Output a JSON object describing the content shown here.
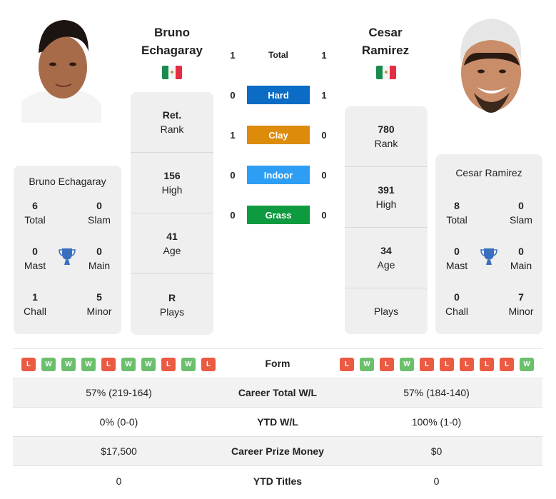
{
  "players": [
    {
      "name_line1": "Bruno",
      "name_line2": "Echagaray",
      "full_name": "Bruno Echagaray",
      "flag": "mexico-flag",
      "stats": [
        {
          "value": "Ret.",
          "label": "Rank"
        },
        {
          "value": "156",
          "label": "High"
        },
        {
          "value": "41",
          "label": "Age"
        },
        {
          "value": "R",
          "label": "Plays"
        }
      ],
      "titles": {
        "total": {
          "value": "6",
          "label": "Total"
        },
        "slam": {
          "value": "0",
          "label": "Slam"
        },
        "mast": {
          "value": "0",
          "label": "Mast"
        },
        "main": {
          "value": "0",
          "label": "Main"
        },
        "chall": {
          "value": "1",
          "label": "Chall"
        },
        "minor": {
          "value": "5",
          "label": "Minor"
        }
      },
      "form": [
        "L",
        "W",
        "W",
        "W",
        "L",
        "W",
        "W",
        "L",
        "W",
        "L"
      ]
    },
    {
      "name_line1": "Cesar",
      "name_line2": "Ramirez",
      "full_name": "Cesar Ramirez",
      "flag": "mexico-flag",
      "stats": [
        {
          "value": "780",
          "label": "Rank"
        },
        {
          "value": "391",
          "label": "High"
        },
        {
          "value": "34",
          "label": "Age"
        },
        {
          "value": "",
          "label": "Plays"
        }
      ],
      "titles": {
        "total": {
          "value": "8",
          "label": "Total"
        },
        "slam": {
          "value": "0",
          "label": "Slam"
        },
        "mast": {
          "value": "0",
          "label": "Mast"
        },
        "main": {
          "value": "0",
          "label": "Main"
        },
        "chall": {
          "value": "0",
          "label": "Chall"
        },
        "minor": {
          "value": "7",
          "label": "Minor"
        }
      },
      "form": [
        "L",
        "W",
        "L",
        "W",
        "L",
        "L",
        "L",
        "L",
        "L",
        "W"
      ]
    }
  ],
  "h2h": [
    {
      "label": "Total",
      "left": "1",
      "right": "1",
      "color": ""
    },
    {
      "label": "Hard",
      "left": "0",
      "right": "1",
      "color": "#0a6cc4"
    },
    {
      "label": "Clay",
      "left": "1",
      "right": "0",
      "color": "#dd8b0a"
    },
    {
      "label": "Indoor",
      "left": "0",
      "right": "0",
      "color": "#2e9ef4"
    },
    {
      "label": "Grass",
      "left": "0",
      "right": "0",
      "color": "#0e9a3e"
    }
  ],
  "form_label": "Form",
  "comparison": [
    {
      "label": "Career Total W/L",
      "left": "57% (219-164)",
      "right": "57% (184-140)"
    },
    {
      "label": "YTD W/L",
      "left": "0% (0-0)",
      "right": "100% (1-0)"
    },
    {
      "label": "Career Prize Money",
      "left": "$17,500",
      "right": "$0"
    },
    {
      "label": "YTD Titles",
      "left": "0",
      "right": "0"
    }
  ]
}
